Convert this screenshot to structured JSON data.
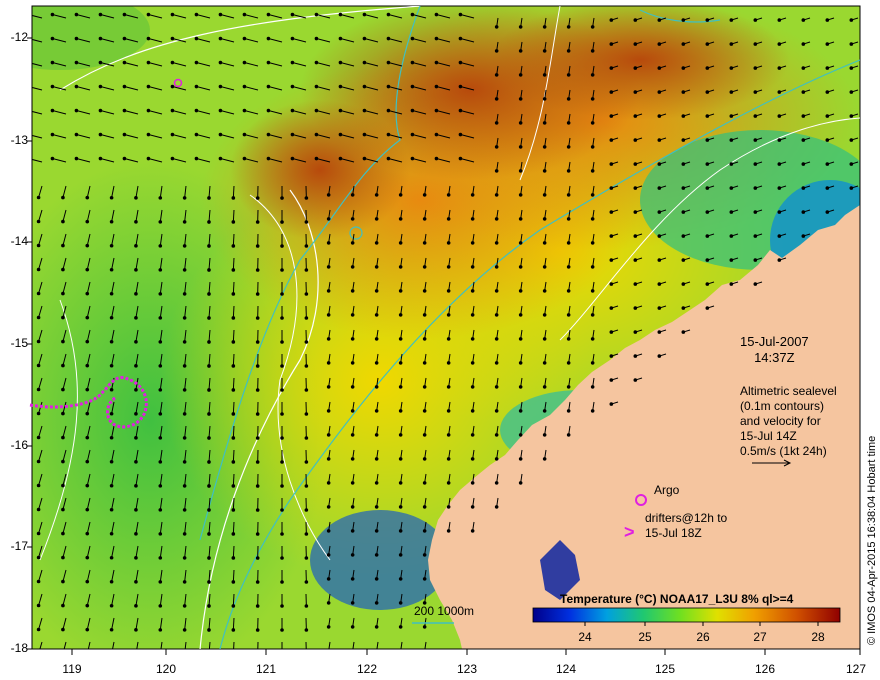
{
  "map": {
    "y_ticks": [
      "-12",
      "-13",
      "-14",
      "-15",
      "-16",
      "-17",
      "-18"
    ],
    "x_ticks": [
      "119",
      "120",
      "121",
      "122",
      "123",
      "124",
      "125",
      "126",
      "127"
    ],
    "date": "15-Jul-2007",
    "time": "14:37Z",
    "altimetry_lines": [
      "Altimetric sealevel",
      "(0.1m contours)",
      "and velocity for",
      "15-Jul 14Z",
      "0.5m/s (1kt 24h)"
    ],
    "argo_label": "Argo",
    "drifter_lines": [
      "drifters@12h to",
      "15-Jul 18Z"
    ],
    "bathymetry_label": "200  1000m",
    "colorbar_title": "Temperature (°C) NOAA17_L3U 8% ql>=4",
    "colorbar_ticks": [
      "24",
      "25",
      "26",
      "27",
      "28"
    ],
    "credit": "© IMOS 04-Apr-2015 16:38:04 Hobart time",
    "colors": {
      "land": "#f5c59f",
      "sst_cold": "#1e20a0",
      "sst_warm": "#b34a0a",
      "contour": "#ffffff",
      "bathymetry": "#40c0c0",
      "argo": "#e020e0"
    },
    "domain": {
      "lon": [
        118.6,
        127
      ],
      "lat": [
        -18,
        -11.8
      ]
    }
  }
}
